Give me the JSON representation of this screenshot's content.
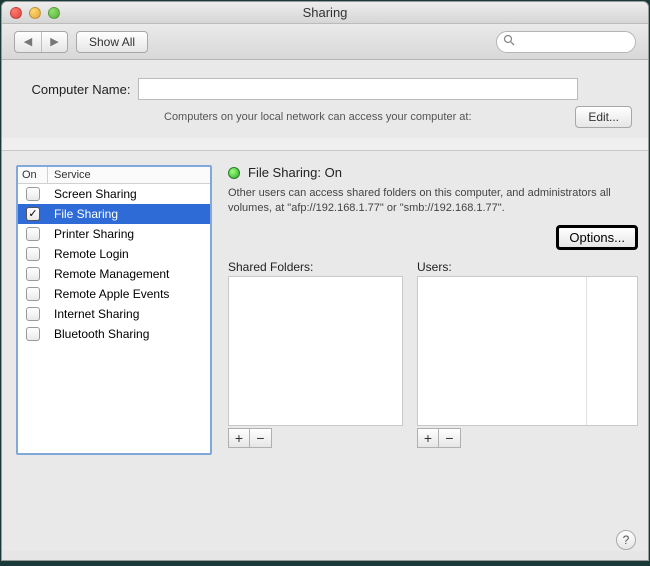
{
  "window": {
    "title": "Sharing"
  },
  "toolbar": {
    "show_all": "Show All",
    "search_placeholder": ""
  },
  "computer_name": {
    "label": "Computer Name:",
    "value": "",
    "hint": "Computers on your local network can access your computer at:",
    "edit_button": "Edit..."
  },
  "services": {
    "header_on": "On",
    "header_service": "Service",
    "items": [
      {
        "label": "Screen Sharing",
        "checked": false,
        "selected": false
      },
      {
        "label": "File Sharing",
        "checked": true,
        "selected": true
      },
      {
        "label": "Printer Sharing",
        "checked": false,
        "selected": false
      },
      {
        "label": "Remote Login",
        "checked": false,
        "selected": false
      },
      {
        "label": "Remote Management",
        "checked": false,
        "selected": false
      },
      {
        "label": "Remote Apple Events",
        "checked": false,
        "selected": false
      },
      {
        "label": "Internet Sharing",
        "checked": false,
        "selected": false
      },
      {
        "label": "Bluetooth Sharing",
        "checked": false,
        "selected": false
      }
    ]
  },
  "detail": {
    "status_title": "File Sharing: On",
    "status_color": "#2fa82f",
    "description": "Other users can access shared folders on this computer, and administrators all volumes, at \"afp://192.168.1.77\" or \"smb://192.168.1.77\".",
    "options_button": "Options...",
    "shared_folders_label": "Shared Folders:",
    "users_label": "Users:",
    "add_glyph": "+",
    "remove_glyph": "−"
  },
  "help_glyph": "?"
}
